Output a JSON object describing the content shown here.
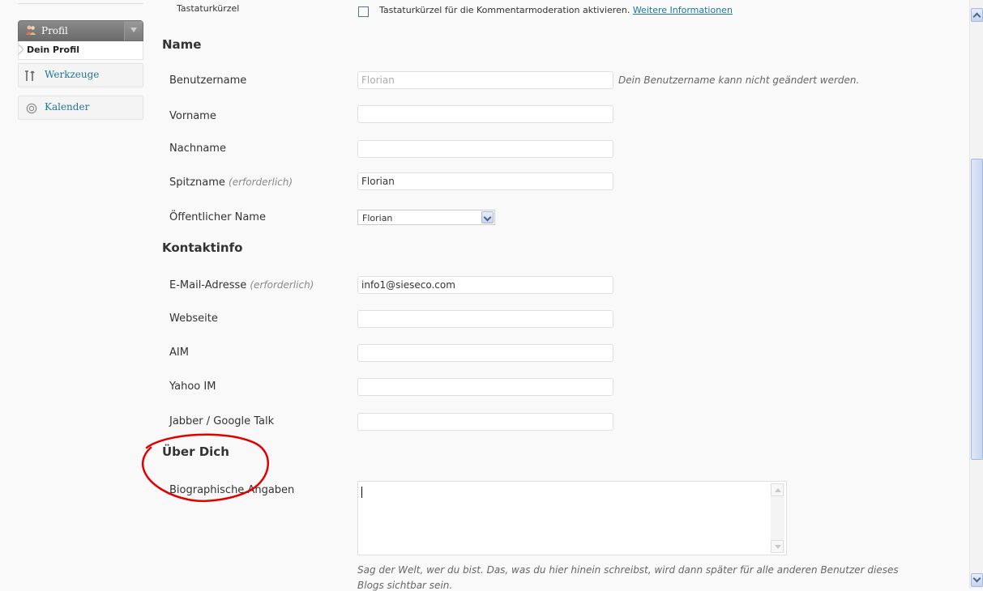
{
  "sidebar": {
    "profile_menu": {
      "label": "Profil",
      "submenu_active": "Dein Profil"
    },
    "items": [
      {
        "label": "Werkzeuge",
        "icon": "tools-icon"
      },
      {
        "label": "Kalender",
        "icon": "calendar-icon"
      }
    ]
  },
  "top_row": {
    "label": "Tastaturkürzel",
    "checkbox_text": "Tastaturkürzel für die Kommentarmoderation aktivieren.",
    "link_text": "Weitere Informationen"
  },
  "name_section": {
    "heading": "Name",
    "username": {
      "label": "Benutzername",
      "value": "Florian",
      "hint": "Dein Benutzername kann nicht geändert werden."
    },
    "firstname": {
      "label": "Vorname",
      "value": ""
    },
    "lastname": {
      "label": "Nachname",
      "value": ""
    },
    "nickname": {
      "label": "Spitzname",
      "required": "(erforderlich)",
      "value": "Florian"
    },
    "display_name": {
      "label": "Öffentlicher Name",
      "selected": "Florian"
    }
  },
  "contact_section": {
    "heading": "Kontaktinfo",
    "email": {
      "label": "E-Mail-Adresse",
      "required": "(erforderlich)",
      "value": "info1@sieseco.com"
    },
    "website": {
      "label": "Webseite",
      "value": ""
    },
    "aim": {
      "label": "AIM",
      "value": ""
    },
    "yahoo": {
      "label": "Yahoo IM",
      "value": ""
    },
    "jabber": {
      "label": "Jabber / Google Talk",
      "value": ""
    }
  },
  "about_section": {
    "heading": "Über Dich",
    "bio": {
      "label": "Biographische Angaben",
      "value": ""
    },
    "description": "Sag der Welt, wer du bist. Das, was du hier hinein schreibst, wird dann später für alle anderen Benutzer dieses",
    "description_line2": "Blogs sichtbar sein."
  },
  "colors": {
    "link": "#21759b",
    "annotation": "#e00000",
    "menu_head": "#7a7a7a"
  }
}
